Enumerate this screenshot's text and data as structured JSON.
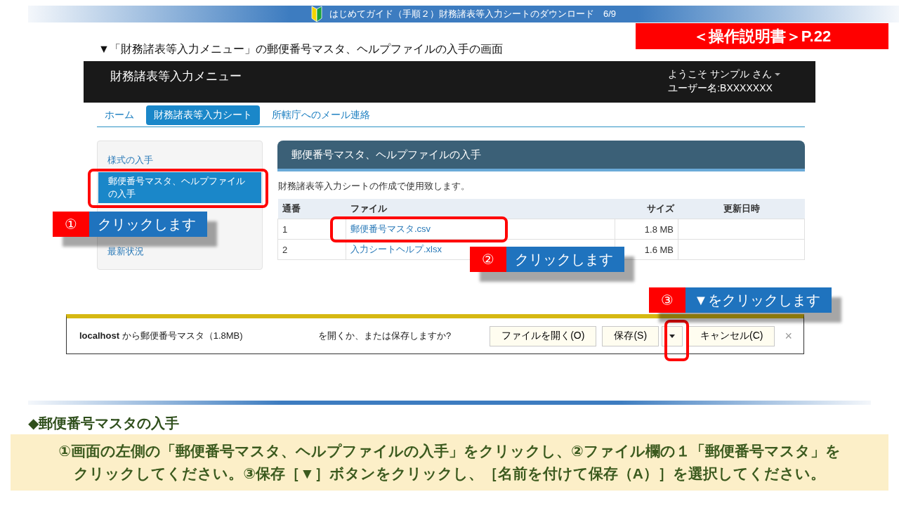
{
  "slide_header": {
    "title": "はじめてガイド（手順２）財務諸表等入力シートのダウンロード　6/9"
  },
  "caption": "▼「財務諸表等入力メニュー」の郵便番号マスタ、ヘルプファイルの入手の画面",
  "manual_ref": "＜操作説明書＞P.22",
  "app": {
    "title": "財務諸表等入力メニュー",
    "user_greeting": "ようこそ サンプル さん",
    "user_name": "ユーザー名:BXXXXXXX",
    "tabs": [
      {
        "label": "ホーム",
        "selected": false
      },
      {
        "label": "財務諸表等入力シート",
        "selected": true
      },
      {
        "label": "所轄庁へのメール連絡",
        "selected": false
      }
    ],
    "sidebar": {
      "items": [
        {
          "label": "様式の入手",
          "selected": false
        },
        {
          "label": "郵便番号マスタ、ヘルプファイルの入手",
          "selected": true
        },
        {
          "label": "最新状況",
          "selected": false
        }
      ]
    },
    "panel": {
      "title": "郵便番号マスタ、ヘルプファイルの入手",
      "description": "財務諸表等入力シートの作成で使用致します。",
      "table": {
        "columns": [
          "通番",
          "ファイル",
          "サイズ",
          "更新日時"
        ],
        "rows": [
          {
            "number": "1",
            "file": "郵便番号マスタ.csv",
            "size": "1.8 MB"
          },
          {
            "number": "2",
            "file": "入力シートヘルプ.xlsx",
            "size": "1.6 MB"
          }
        ]
      }
    }
  },
  "download_bar": {
    "source": "**localhost** から郵便番号マスタ（1.8MB)",
    "question": "を開くか、または保存しますか?",
    "open_button": "ファイルを開く(O)",
    "save_button": "保存(S)",
    "cancel_button": "キャンセル(C)",
    "close": "×"
  },
  "callouts": [
    {
      "number": "①",
      "text": "クリックします"
    },
    {
      "number": "②",
      "text": "クリックします"
    },
    {
      "number": "③",
      "text": "▼をクリックします"
    }
  ],
  "section": {
    "heading": "◆郵便番号マスタの入手",
    "body_lines": [
      "①画面の左側の「郵便番号マスタ、ヘルプファイルの入手」をクリックし、②ファイル欄の１「郵便番号マスタ」を",
      "クリックしてください。③保存［▼］ボタンをクリックし、［名前を付けて保存（A）］を選択してください。"
    ]
  }
}
